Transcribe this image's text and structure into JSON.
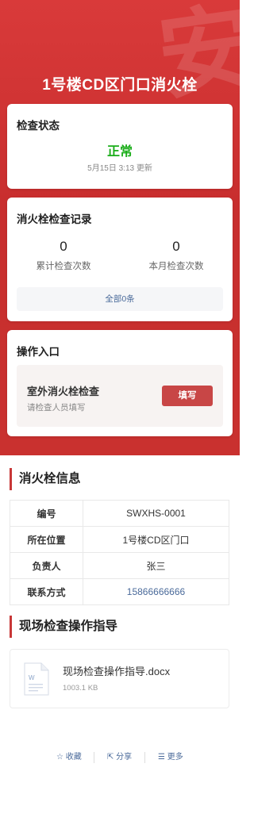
{
  "header": {
    "title": "1号楼CD区门口消火栓",
    "decor_glyph": "安"
  },
  "status": {
    "title": "检查状态",
    "value": "正常",
    "updated": "5月15日 3:13 更新",
    "value_color": "#1aad19"
  },
  "records": {
    "title": "消火栓检查记录",
    "stats": [
      {
        "value": "0",
        "label": "累计检查次数"
      },
      {
        "value": "0",
        "label": "本月检查次数"
      }
    ],
    "all_label": "全部0条"
  },
  "operations": {
    "title": "操作入口",
    "entry": {
      "name": "室外消火栓检查",
      "sub": "请检查人员填写",
      "button": "填写"
    }
  },
  "info": {
    "title": "消火栓信息",
    "rows": [
      {
        "key": "编号",
        "value": "SWXHS-0001"
      },
      {
        "key": "所在位置",
        "value": "1号楼CD区门口"
      },
      {
        "key": "负责人",
        "value": "张三"
      },
      {
        "key": "联系方式",
        "value": "15866666666"
      }
    ]
  },
  "guide": {
    "title": "现场检查操作指导",
    "file": {
      "icon_letter": "W",
      "name": "现场检查操作指导.docx",
      "size": "1003.1 KB"
    }
  },
  "footer": {
    "favorite": {
      "icon": "☆",
      "label": "收藏"
    },
    "share": {
      "icon": "⇱",
      "label": "分享"
    },
    "more": {
      "icon": "☰",
      "label": "更多"
    }
  },
  "colors": {
    "brand_red": "#c83737",
    "link_blue": "#4a6a9a",
    "ok_green": "#1aad19"
  }
}
